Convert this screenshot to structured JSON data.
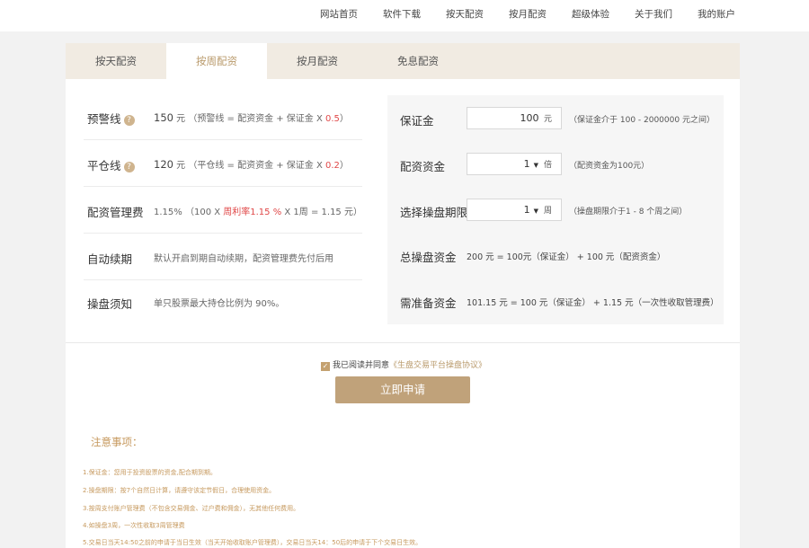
{
  "topnav": [
    "网站首页",
    "软件下载",
    "按天配资",
    "按月配资",
    "超级体验",
    "关于我们",
    "我的账户"
  ],
  "tabs": [
    "按天配资",
    "按周配资",
    "按月配资",
    "免息配资"
  ],
  "active_tab": "按周配资",
  "left": {
    "warning_line": {
      "label": "预警线",
      "value": "150",
      "unit": "元",
      "formula": "（预警线 = 配资资金 + 保证金 X ",
      "rate": "0.5",
      "close": "）"
    },
    "closeout_line": {
      "label": "平仓线",
      "value": "120",
      "unit": "元",
      "formula": "（平仓线 = 配资资金 + 保证金 X ",
      "rate": "0.2",
      "close": "）"
    },
    "mgmt_fee": {
      "label": "配资管理费",
      "pct": "1.15%",
      "formula_a": "（100 X ",
      "rate_label": "周利率1.15 %",
      "formula_b": " X 1周 = 1.15 元）"
    },
    "auto_renew": {
      "label": "自动续期",
      "text": "默认开启到期自动续期，配资管理费先付后用"
    },
    "notice": {
      "label": "操盘须知",
      "text": "单只股票最大持仓比例为 90%。"
    }
  },
  "right": {
    "margin": {
      "label": "保证金",
      "value": "100",
      "unit": "元",
      "hint": "（保证金介于 100 - 2000000 元之间）"
    },
    "leverage": {
      "label": "配资资金",
      "value": "1",
      "unit": "倍",
      "hint": "（配资资金为100元）"
    },
    "period": {
      "label": "选择操盘期限",
      "value": "1",
      "unit": "周",
      "hint": "（操盘期限介于1 - 8 个周之间）"
    },
    "total": {
      "label": "总操盘资金",
      "text": "200 元 = 100元（保证金） + 100 元（配资资金）"
    },
    "prepare": {
      "label": "需准备资金",
      "text": "101.15 元 = 100 元（保证金） + 1.15 元（一次性收取管理费）"
    }
  },
  "agreement": {
    "prefix": "我已阅读并同意",
    "link": "《生盘交易平台操盘协议》"
  },
  "apply_label": "立即申请",
  "notice_title": "注意事项：",
  "notes": [
    "1.保证金：您用于投资股票的资金,配合期到期。",
    "2.操盘期限：按7个自然日计算，请遵守该定节假日，合理使用资金。",
    "3.按周支付账户管理费（不包含交易佣金、过户费和佣金），无其他任何费用。",
    "4.如操盘3周，一次性收取3周管理费",
    "5.交易日当天14:50之前的申请于当日生效（当天开始收取账户管理费），交易日当天14：50后的申请于下个交易日生效。"
  ],
  "colors": {
    "accent": "#c0a27a",
    "tab_bg": "#f1ebe2",
    "red": "#e04848",
    "note": "#c6995e"
  }
}
